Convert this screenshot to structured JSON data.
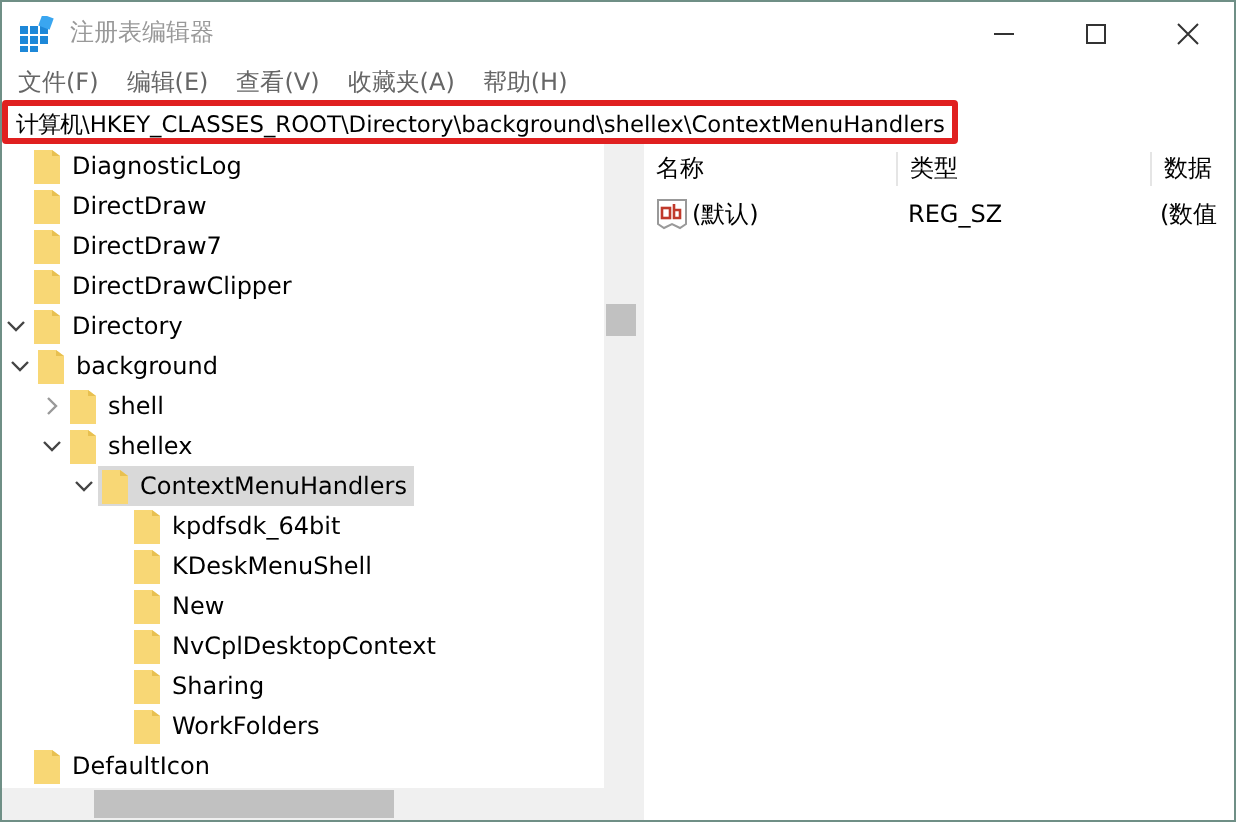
{
  "window": {
    "title": "注册表编辑器"
  },
  "menu": [
    "文件(F)",
    "编辑(E)",
    "查看(V)",
    "收藏夹(A)",
    "帮助(H)"
  ],
  "address": {
    "value": "计算机\\HKEY_CLASSES_ROOT\\Directory\\background\\shellex\\ContextMenuHandlers",
    "highlighted": true
  },
  "tree": [
    {
      "name": "DiagnosticLog",
      "selected": false
    },
    {
      "name": "DirectDraw",
      "selected": false
    },
    {
      "name": "DirectDraw7",
      "selected": false
    },
    {
      "name": "DirectDrawClipper",
      "selected": false
    },
    {
      "name": "Directory",
      "selected": false,
      "expanded": true,
      "children": [
        {
          "name": "background",
          "selected": false,
          "expanded": true,
          "children": [
            {
              "name": "shell",
              "selected": false,
              "expanded": false,
              "has_children": true
            },
            {
              "name": "shellex",
              "selected": false,
              "expanded": true,
              "children": [
                {
                  "name": "ContextMenuHandlers",
                  "selected": true,
                  "expanded": true,
                  "children": [
                    {
                      "name": "kpdfsdk_64bit",
                      "selected": false
                    },
                    {
                      "name": "KDeskMenuShell",
                      "selected": false
                    },
                    {
                      "name": "New",
                      "selected": false
                    },
                    {
                      "name": "NvCplDesktopContext",
                      "selected": false
                    },
                    {
                      "name": "Sharing",
                      "selected": false
                    },
                    {
                      "name": "WorkFolders",
                      "selected": false
                    }
                  ]
                }
              ]
            }
          ]
        }
      ]
    },
    {
      "name": "DefaultIcon",
      "selected": false
    }
  ],
  "list": {
    "columns": [
      "名称",
      "类型",
      "数据"
    ],
    "rows": [
      {
        "name": "(默认)",
        "type": "REG_SZ",
        "data": "(数值"
      }
    ]
  }
}
